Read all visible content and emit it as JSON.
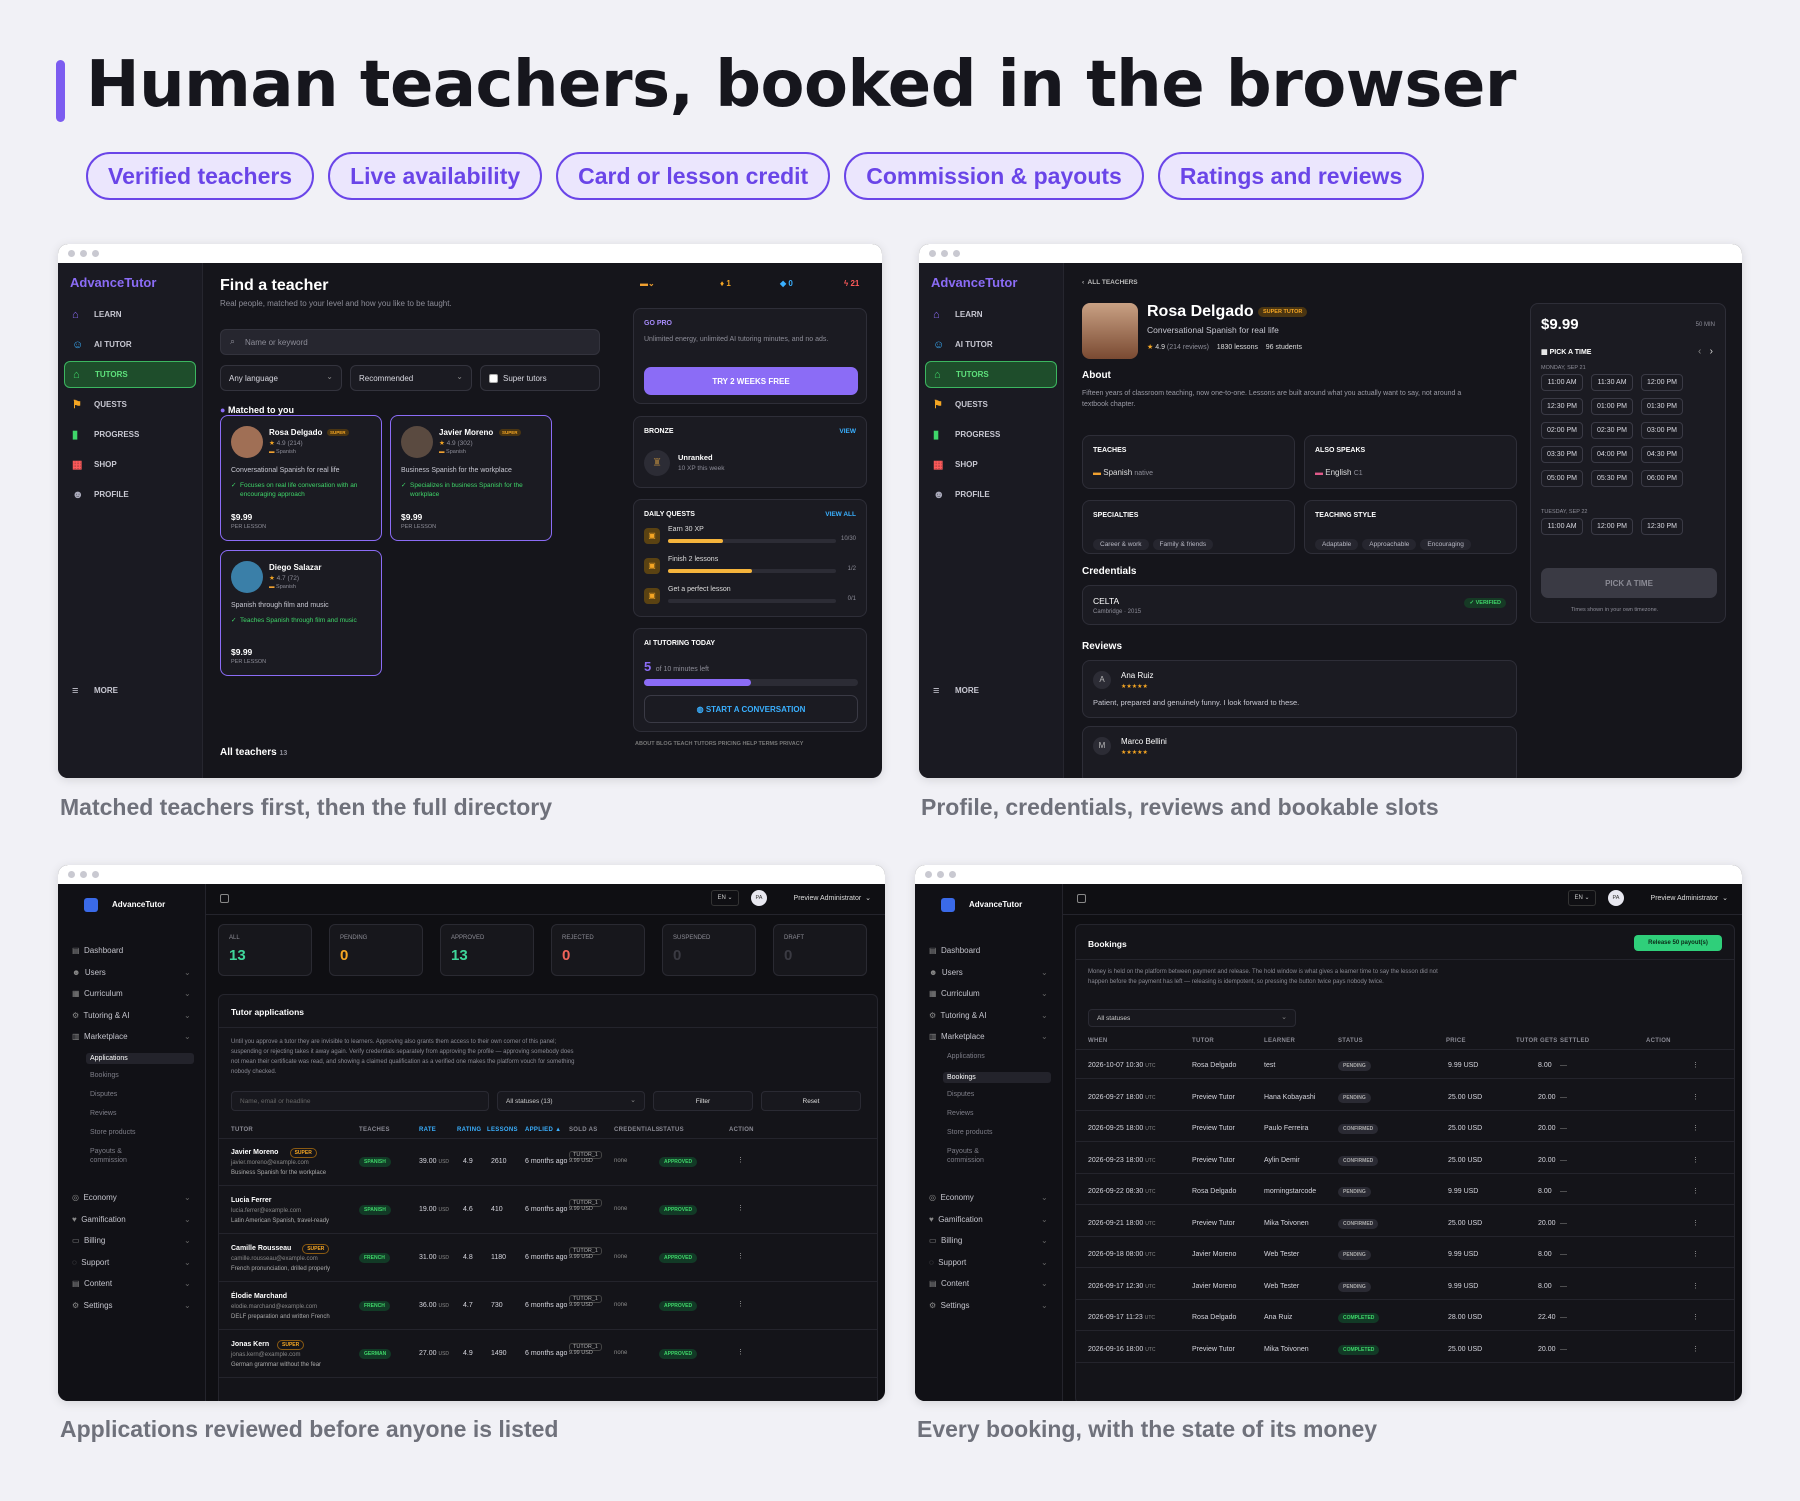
{
  "hero": {
    "title": "Human teachers, booked in the browser",
    "pills": [
      "Verified teachers",
      "Live availability",
      "Card or lesson credit",
      "Commission & payouts",
      "Ratings and reviews"
    ]
  },
  "captions": [
    "Matched teachers first, then the full directory",
    "Profile, credentials, reviews and bookable slots",
    "Applications reviewed before anyone is listed",
    "Every booking, with the state of its money"
  ],
  "app": {
    "logo": "AdvanceTutor",
    "nav": [
      "LEARN",
      "AI TUTOR",
      "TUTORS",
      "QUESTS",
      "PROGRESS",
      "SHOP",
      "PROFILE"
    ],
    "more": "MORE"
  },
  "find": {
    "title": "Find a teacher",
    "subtitle": "Real people, matched to your level and how you like to be taught.",
    "search_placeholder": "Name or keyword",
    "lang": "Any language",
    "sort": "Recommended",
    "super": "Super tutors",
    "matched": "Matched to you",
    "all": "All teachers",
    "all_count": "13",
    "teachers": [
      {
        "name": "Rosa Delgado",
        "badge": "SUPER",
        "rating": "4.9",
        "reviews": "(214)",
        "lang": "Spanish",
        "headline": "Conversational Spanish for real life",
        "focus": "Focuses on real life conversation with an encouraging approach",
        "price": "$9.99",
        "per": "PER LESSON"
      },
      {
        "name": "Javier Moreno",
        "badge": "SUPER",
        "rating": "4.9",
        "reviews": "(302)",
        "lang": "Spanish",
        "headline": "Business Spanish for the workplace",
        "focus": "Specializes in business Spanish for the workplace",
        "price": "$9.99",
        "per": "PER LESSON"
      },
      {
        "name": "Diego Salazar",
        "badge": "",
        "rating": "4.7",
        "reviews": "(72)",
        "lang": "Spanish",
        "headline": "Spanish through film and music",
        "focus": "Teaches Spanish through film and music",
        "price": "$9.99",
        "per": "PER LESSON"
      }
    ],
    "stats": {
      "flame": "1",
      "gem": "0",
      "bolt": "21"
    },
    "gopro": {
      "label": "GO PRO",
      "text": "Unlimited energy, unlimited AI tutoring minutes, and no ads.",
      "button": "TRY 2 WEEKS FREE"
    },
    "league": {
      "label": "BRONZE",
      "view": "VIEW",
      "rank": "Unranked",
      "xp": "10 XP this week"
    },
    "quests": {
      "label": "DAILY QUESTS",
      "view": "VIEW ALL",
      "items": [
        {
          "name": "Earn 30 XP",
          "count": "10/30",
          "progress": 0.33
        },
        {
          "name": "Finish 2 lessons",
          "count": "1/2",
          "progress": 0.5
        },
        {
          "name": "Get a perfect lesson",
          "count": "0/1",
          "progress": 0
        }
      ]
    },
    "ai": {
      "label": "AI TUTORING TODAY",
      "minutes": "5",
      "of": "of 10 minutes left",
      "progress": 0.5,
      "button": "START A CONVERSATION"
    },
    "footer": "ABOUT  BLOG  TEACH  TUTORS  PRICING  HELP  TERMS  PRIVACY"
  },
  "profile": {
    "back": "ALL TEACHERS",
    "name": "Rosa Delgado",
    "badge": "SUPER TUTOR",
    "headline": "Conversational Spanish for real life",
    "rating": "4.9",
    "reviews": "(214 reviews)",
    "lessons": "1830 lessons",
    "students": "96 students",
    "about_h": "About",
    "about": "Fifteen years of classroom teaching, now one-to-one. Lessons are built around what you actually want to say, not around a textbook chapter.",
    "teaches_h": "TEACHES",
    "teaches": "Spanish",
    "teaches_lvl": "native",
    "speaks_h": "ALSO SPEAKS",
    "speaks": "English",
    "speaks_lvl": "C1",
    "spec_h": "SPECIALTIES",
    "spec": [
      "Career & work",
      "Family & friends"
    ],
    "style_h": "TEACHING STYLE",
    "style": [
      "Adaptable",
      "Approachable",
      "Encouraging"
    ],
    "cred_h": "Credentials",
    "cred": "CELTA",
    "cred_sub": "Cambridge · 2015",
    "verified": "VERIFIED",
    "rev_h": "Reviews",
    "reviews_list": [
      {
        "initial": "A",
        "name": "Ana Ruiz",
        "text": "Patient, prepared and genuinely funny. I look forward to these."
      },
      {
        "initial": "M",
        "name": "Marco Bellini",
        "text": ""
      }
    ],
    "price": "$9.99",
    "dur": "50 MIN",
    "pick": "PICK A TIME",
    "day1": "MONDAY, SEP 21",
    "slots1": [
      "11:00 AM",
      "11:30 AM",
      "12:00 PM",
      "12:30 PM",
      "01:00 PM",
      "01:30 PM",
      "02:00 PM",
      "02:30 PM",
      "03:00 PM",
      "03:30 PM",
      "04:00 PM",
      "04:30 PM",
      "05:00 PM",
      "05:30 PM",
      "06:00 PM"
    ],
    "day2": "TUESDAY, SEP 22",
    "slots2": [
      "11:00 AM",
      "12:00 PM",
      "12:30 PM"
    ],
    "btn": "PICK A TIME",
    "tz": "Times shown in your own timezone."
  },
  "admin": {
    "brand": "AdvanceTutor",
    "lang": "EN",
    "user": "Preview Administrator",
    "initials": "PA",
    "nav": [
      "Dashboard",
      "Users",
      "Curriculum",
      "Tutoring & AI",
      "Marketplace"
    ],
    "market_sub": [
      "Applications",
      "Bookings",
      "Disputes",
      "Reviews",
      "Store products",
      "Payouts &",
      "commission"
    ],
    "nav2": [
      "Economy",
      "Gamification",
      "Billing",
      "Support",
      "Content",
      "Settings"
    ]
  },
  "apps": {
    "stats": [
      {
        "label": "ALL",
        "value": "13",
        "color": "#3fd69a"
      },
      {
        "label": "PENDING",
        "value": "0",
        "color": "#f5a623"
      },
      {
        "label": "APPROVED",
        "value": "13",
        "color": "#3fd69a"
      },
      {
        "label": "REJECTED",
        "value": "0",
        "color": "#f0645a"
      },
      {
        "label": "SUSPENDED",
        "value": "0",
        "color": "#3a3a42"
      },
      {
        "label": "DRAFT",
        "value": "0",
        "color": "#3a3a42"
      }
    ],
    "title": "Tutor applications",
    "desc": "Until you approve a tutor they are invisible to learners. Approving also grants them access to their own corner of this panel; suspending or rejecting takes it away again. Verify credentials separately from approving the profile — approving somebody does not mean their certificate was read, and showing a claimed qualification as a verified one makes the platform vouch for something nobody checked.",
    "search": "Name, email or headline",
    "status": "All statuses (13)",
    "filter": "Filter",
    "reset": "Reset",
    "cols": [
      "TUTOR",
      "TEACHES",
      "RATE",
      "RATING",
      "LESSONS",
      "APPLIED ▲",
      "SOLD AS",
      "CREDENTIALS",
      "STATUS",
      "ACTION"
    ],
    "rows": [
      {
        "name": "Javier Moreno",
        "super": "SUPER",
        "email": "javier.moreno@example.com",
        "head": "Business Spanish for the workplace",
        "lang": "SPANISH",
        "rate": "39.00",
        "rating": "4.9",
        "lessons": "2610",
        "applied": "6 months ago",
        "sold": "TUTOR_1",
        "sold2": "9.99 USD",
        "cred": "none",
        "status": "APPROVED"
      },
      {
        "name": "Lucia Ferrer",
        "super": "",
        "email": "lucia.ferrer@example.com",
        "head": "Latin American Spanish, travel-ready",
        "lang": "SPANISH",
        "rate": "19.00",
        "rating": "4.6",
        "lessons": "410",
        "applied": "6 months ago",
        "sold": "TUTOR_1",
        "sold2": "9.99 USD",
        "cred": "none",
        "status": "APPROVED"
      },
      {
        "name": "Camille Rousseau",
        "super": "SUPER",
        "email": "camille.rousseau@example.com",
        "head": "French pronunciation, drilled properly",
        "lang": "FRENCH",
        "rate": "31.00",
        "rating": "4.8",
        "lessons": "1180",
        "applied": "6 months ago",
        "sold": "TUTOR_1",
        "sold2": "9.99 USD",
        "cred": "none",
        "status": "APPROVED"
      },
      {
        "name": "Élodie Marchand",
        "super": "",
        "email": "elodie.marchand@example.com",
        "head": "DELF preparation and written French",
        "lang": "FRENCH",
        "rate": "36.00",
        "rating": "4.7",
        "lessons": "730",
        "applied": "6 months ago",
        "sold": "TUTOR_1",
        "sold2": "9.99 USD",
        "cred": "none",
        "status": "APPROVED"
      },
      {
        "name": "Jonas Kern",
        "super": "SUPER",
        "email": "jonas.kern@example.com",
        "head": "German grammar without the fear",
        "lang": "GERMAN",
        "rate": "27.00",
        "rating": "4.9",
        "lessons": "1490",
        "applied": "6 months ago",
        "sold": "TUTOR_1",
        "sold2": "9.99 USD",
        "cred": "none",
        "status": "APPROVED"
      }
    ]
  },
  "bookings": {
    "title": "Bookings",
    "release": "Release 50 payout(s)",
    "desc": "Money is held on the platform between payment and release. The hold window is what gives a learner time to say the lesson did not happen before the payment has left — releasing is idempotent, so pressing the button twice pays nobody twice.",
    "status": "All statuses",
    "cols": [
      "WHEN",
      "TUTOR",
      "LEARNER",
      "STATUS",
      "PRICE",
      "TUTOR GETS",
      "SETTLED",
      "ACTION"
    ],
    "rows": [
      {
        "when": "2026-10-07 10:30",
        "tutor": "Rosa Delgado",
        "learner": "test",
        "status": "PENDING",
        "price": "9.99 USD",
        "gets": "8.00"
      },
      {
        "when": "2026-09-27 18:00",
        "tutor": "Preview Tutor",
        "learner": "Hana Kobayashi",
        "status": "PENDING",
        "price": "25.00 USD",
        "gets": "20.00"
      },
      {
        "when": "2026-09-25 18:00",
        "tutor": "Preview Tutor",
        "learner": "Paulo Ferreira",
        "status": "CONFIRMED",
        "price": "25.00 USD",
        "gets": "20.00"
      },
      {
        "when": "2026-09-23 18:00",
        "tutor": "Preview Tutor",
        "learner": "Aylin Demir",
        "status": "CONFIRMED",
        "price": "25.00 USD",
        "gets": "20.00"
      },
      {
        "when": "2026-09-22 08:30",
        "tutor": "Rosa Delgado",
        "learner": "morningstarcode",
        "status": "PENDING",
        "price": "9.99 USD",
        "gets": "8.00"
      },
      {
        "when": "2026-09-21 18:00",
        "tutor": "Preview Tutor",
        "learner": "Mika Toivonen",
        "status": "CONFIRMED",
        "price": "25.00 USD",
        "gets": "20.00"
      },
      {
        "when": "2026-09-18 08:00",
        "tutor": "Javier Moreno",
        "learner": "Web Tester",
        "status": "PENDING",
        "price": "9.99 USD",
        "gets": "8.00"
      },
      {
        "when": "2026-09-17 12:30",
        "tutor": "Javier Moreno",
        "learner": "Web Tester",
        "status": "PENDING",
        "price": "9.99 USD",
        "gets": "8.00"
      },
      {
        "when": "2026-09-17 11:23",
        "tutor": "Rosa Delgado",
        "learner": "Ana Ruiz",
        "status": "COMPLETED",
        "price": "28.00 USD",
        "gets": "22.40"
      },
      {
        "when": "2026-09-16 18:00",
        "tutor": "Preview Tutor",
        "learner": "Mika Toivonen",
        "status": "COMPLETED",
        "price": "25.00 USD",
        "gets": "20.00"
      }
    ],
    "tz": "UTC",
    "dash": "—"
  }
}
